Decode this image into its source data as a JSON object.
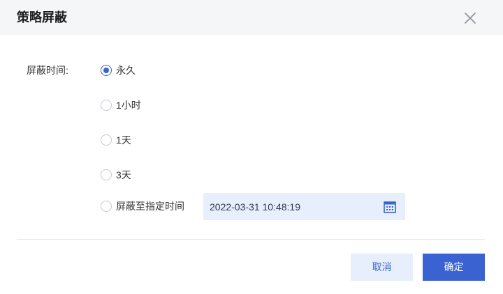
{
  "dialog": {
    "title": "策略屏蔽",
    "close_icon": "close-icon"
  },
  "form": {
    "label": "屏蔽时间:",
    "options": [
      {
        "label": "永久",
        "checked": true
      },
      {
        "label": "1小时",
        "checked": false
      },
      {
        "label": "1天",
        "checked": false
      },
      {
        "label": "3天",
        "checked": false
      },
      {
        "label": "屏蔽至指定时间",
        "checked": false
      }
    ],
    "date_value": "2022-03-31 10:48:19",
    "calendar_icon": "calendar-icon"
  },
  "footer": {
    "cancel_label": "取消",
    "ok_label": "确定"
  },
  "colors": {
    "accent": "#3a63d1",
    "accent_light": "#e8effc",
    "header_bg": "#f5f6f8"
  }
}
